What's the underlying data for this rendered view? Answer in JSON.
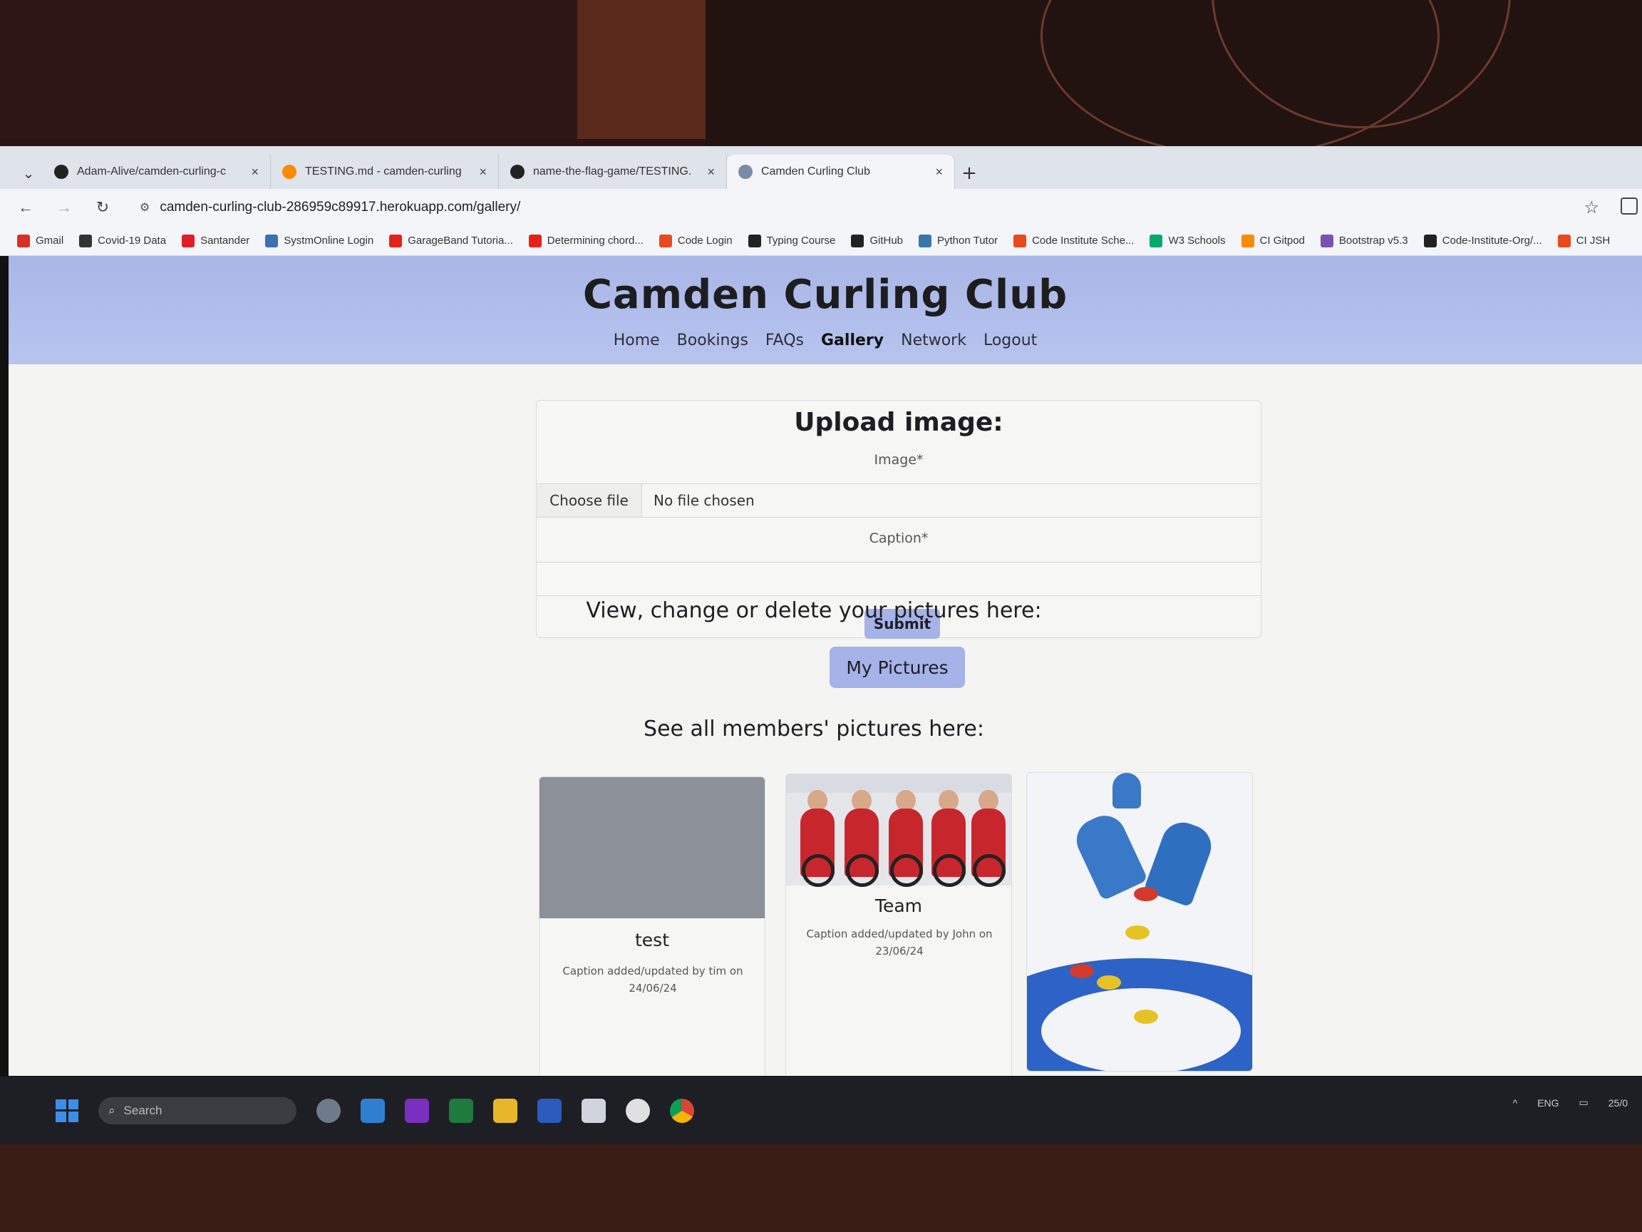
{
  "browser": {
    "tabs": [
      {
        "label": "Adam-Alive/camden-curling-c",
        "icon": "github-icon",
        "active": false
      },
      {
        "label": "TESTING.md - camden-curling",
        "icon": "gitpod-icon",
        "active": false
      },
      {
        "label": "name-the-flag-game/TESTING.",
        "icon": "github-icon",
        "active": false
      },
      {
        "label": "Camden Curling Club",
        "icon": "curling-icon",
        "active": true
      }
    ],
    "new_tab": "+",
    "close": "×",
    "url": "camden-curling-club-286959c89917.herokuapp.com/gallery/",
    "bookmarks": [
      {
        "label": "Gmail",
        "color": "#d93025"
      },
      {
        "label": "Covid-19 Data",
        "color": "#333333"
      },
      {
        "label": "Santander",
        "color": "#e11e26"
      },
      {
        "label": "SystmOnline Login",
        "color": "#3b6fb6"
      },
      {
        "label": "GarageBand Tutoria...",
        "color": "#e62117"
      },
      {
        "label": "Determining chord...",
        "color": "#e62117"
      },
      {
        "label": "Code Login",
        "color": "#e8491d"
      },
      {
        "label": "Typing Course",
        "color": "#222222"
      },
      {
        "label": "GitHub",
        "color": "#222222"
      },
      {
        "label": "Python Tutor",
        "color": "#3776ab"
      },
      {
        "label": "Code Institute Sche...",
        "color": "#e8491d"
      },
      {
        "label": "W3 Schools",
        "color": "#04aa6d"
      },
      {
        "label": "CI Gitpod",
        "color": "#ff8a00"
      },
      {
        "label": "Bootstrap v5.3",
        "color": "#7952b3"
      },
      {
        "label": "Code-Institute-Org/...",
        "color": "#222222"
      },
      {
        "label": "CI JSH",
        "color": "#e8491d"
      }
    ]
  },
  "site": {
    "title": "Camden Curling Club",
    "nav": [
      "Home",
      "Bookings",
      "FAQs",
      "Gallery",
      "Network",
      "Logout"
    ],
    "active_nav": "Gallery"
  },
  "upload": {
    "heading": "Upload image:",
    "image_label": "Image*",
    "choose_file": "Choose file",
    "file_status": "No file chosen",
    "caption_label": "Caption*",
    "submit": "Submit"
  },
  "my_pictures": {
    "heading": "View, change or delete your pictures here:",
    "button": "My Pictures"
  },
  "members": {
    "heading": "See all members' pictures here:",
    "cards": [
      {
        "title": "test",
        "caption": "Caption added/updated by tim on 24/06/24"
      },
      {
        "title": "Team",
        "caption": "Caption added/updated by John on 23/06/24"
      },
      {
        "title": "",
        "caption": ""
      }
    ]
  },
  "taskbar": {
    "search_placeholder": "Search",
    "tray_lang": "ENG",
    "tray_date": "25/0"
  },
  "colors": {
    "header_bg": "#b1bdeb",
    "button_bg": "#a6b3e8"
  }
}
